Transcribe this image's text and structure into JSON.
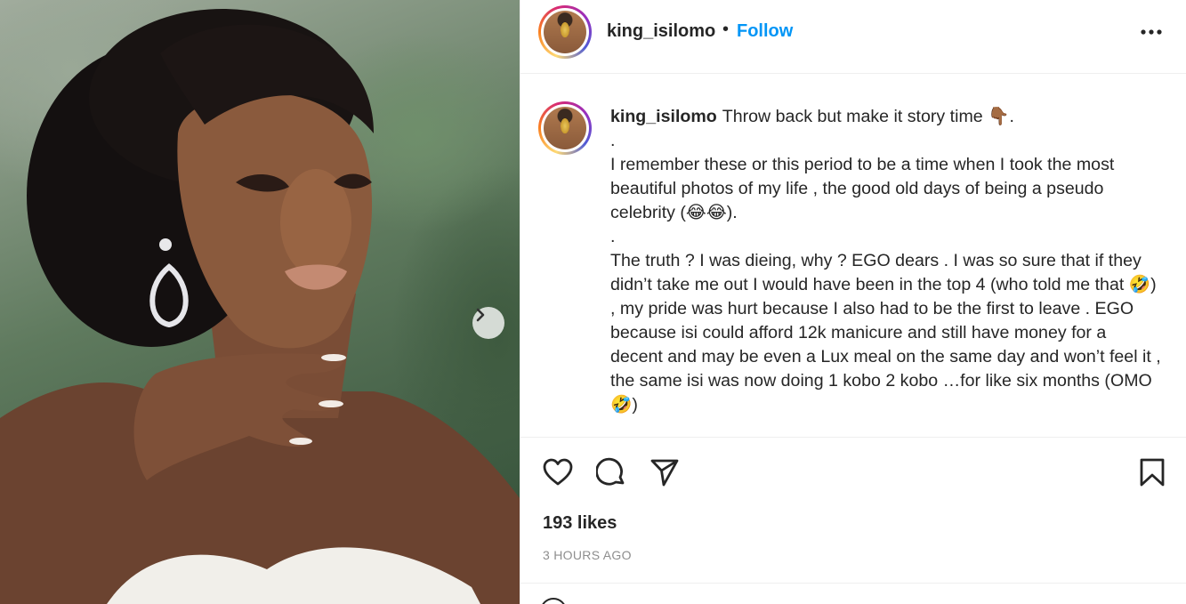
{
  "post": {
    "username": "king_isilomo",
    "separator": "•",
    "follow_label": "Follow",
    "more_icon": "more-options-icon",
    "caption": {
      "username": "king_isilomo",
      "text": "Throw back but make it story time 👇🏾.\n.\nI remember these or this period to be a time when I took the most beautiful photos of my life , the good old days of being a pseudo celebrity (😂😂).\n.\nThe truth ? I was dieing, why ? EGO dears . I was so sure that if they didn’t take me out I would have been in the top 4 (who told me that 🤣) , my pride was hurt because I also had to be the first to leave . EGO because isi could afford 12k manicure and still have money for a decent and may be even a Lux meal on the same day and won’t feel it , the same isi was now doing 1 kobo 2 kobo …for like six months (OMO 🤣)"
    },
    "likes": "193 likes",
    "timestamp": "3 HOURS AGO"
  },
  "icons": {
    "next": "chevron-right-icon",
    "like": "heart-icon",
    "comment": "comment-icon",
    "share": "paper-plane-icon",
    "save": "bookmark-icon"
  },
  "colors": {
    "accent": "#0095f6",
    "text": "#262626",
    "muted": "#8e8e8e",
    "border": "#efefef"
  }
}
